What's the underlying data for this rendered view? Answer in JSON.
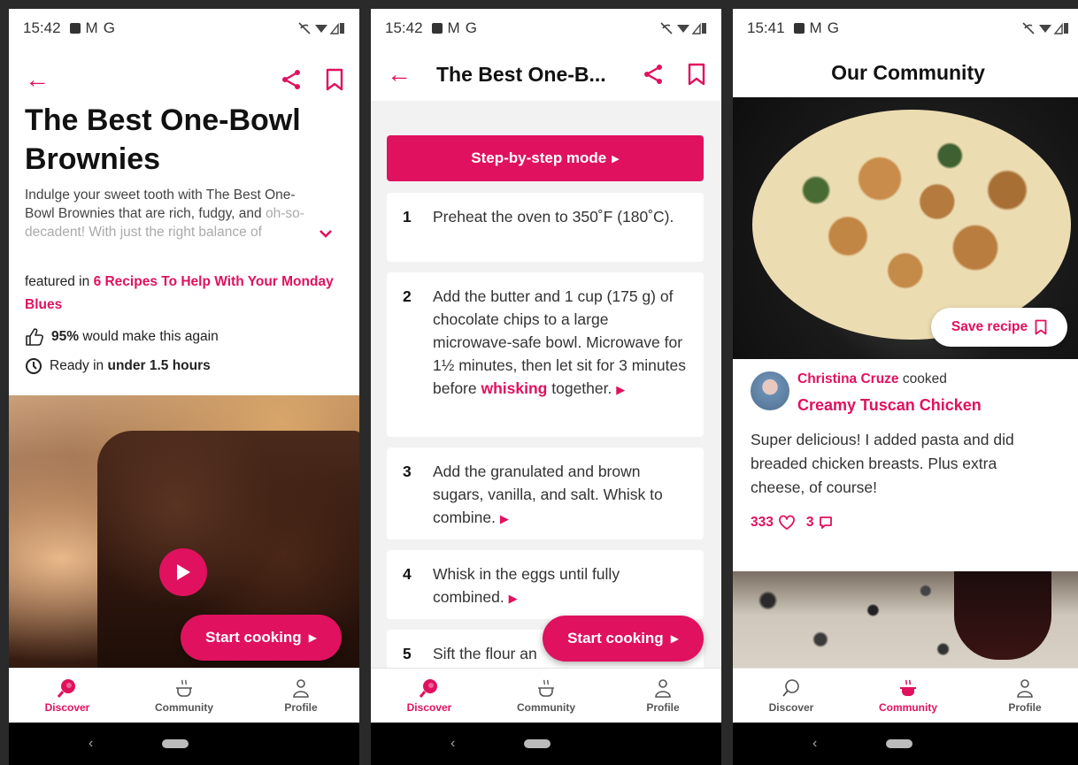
{
  "colors": {
    "accent": "#e0115f",
    "text": "#111111",
    "muted": "#444444"
  },
  "screen1": {
    "status": {
      "time": "15:42",
      "notif_letters": [
        "M",
        "G"
      ]
    },
    "title": "The Best One-Bowl Brownies",
    "description_visible": "Indulge your sweet tooth with The Best One-Bowl Brownies that are rich, fudgy, and",
    "description_faded": "oh-so-decadent! With just the right balance of",
    "featured_prefix": "featured in",
    "featured_link": "6 Recipes To Help With Your Monday Blues",
    "rating_value": "95%",
    "rating_suffix": "would make this again",
    "ready_prefix": "Ready in",
    "ready_value": "under 1.5 hours",
    "start_cooking": "Start cooking"
  },
  "screen2": {
    "status": {
      "time": "15:42",
      "notif_letters": [
        "M",
        "G"
      ]
    },
    "header_title": "The Best One-B...",
    "step_mode": "Step-by-step mode",
    "steps": [
      {
        "num": "1",
        "text": "Preheat the oven to 350˚F (180˚C)."
      },
      {
        "num": "2",
        "text_before": "Add the butter and 1 cup (175 g) of chocolate chips to a large microwave-safe bowl. Microwave for 1½ minutes, then let sit for 3 minutes before",
        "link": "whisking",
        "text_after": "together."
      },
      {
        "num": "3",
        "text": "Add the granulated and brown sugars, vanilla, and salt. Whisk to combine."
      },
      {
        "num": "4",
        "text": "Whisk in the eggs until fully combined."
      },
      {
        "num": "5",
        "text": "Sift the flour an"
      }
    ],
    "start_cooking": "Start cooking"
  },
  "screen3": {
    "status": {
      "time": "15:41",
      "notif_letters": [
        "M",
        "G"
      ]
    },
    "header_title": "Our Community",
    "save_recipe": "Save recipe",
    "user_name": "Christina Cruze",
    "cooked_word": "cooked",
    "dish_name": "Creamy Tuscan Chicken",
    "review": "Super delicious! I added pasta and did breaded chicken breasts. Plus extra cheese, of course!",
    "likes": "333",
    "comments": "3"
  },
  "tabs": {
    "discover": "Discover",
    "community": "Community",
    "profile": "Profile"
  }
}
